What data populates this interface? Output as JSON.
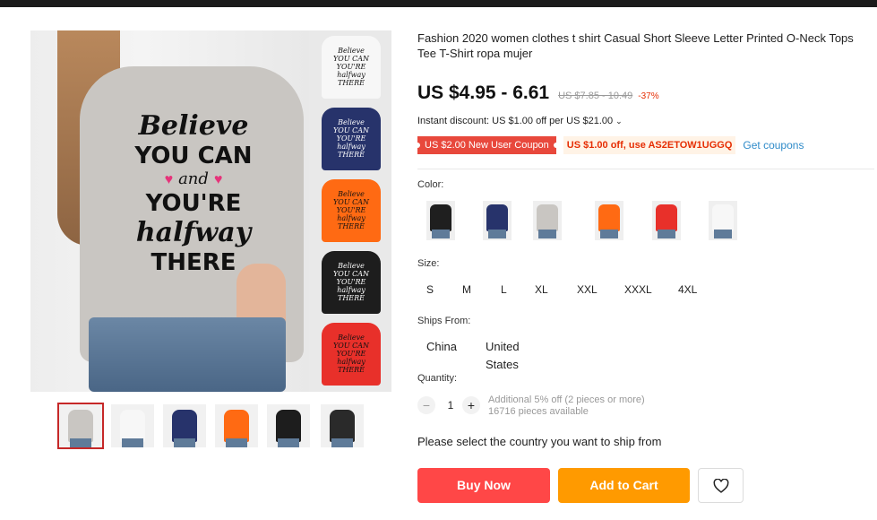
{
  "product": {
    "title": "Fashion 2020 women clothes t shirt Casual Short Sleeve Letter Printed O-Neck Tops Tee T-Shirt ropa mujer",
    "price": "US $4.95 - 6.61",
    "original_price": "US $7.85 - 10.49",
    "discount_percent": "-37%",
    "instant_discount": "Instant discount: US $1.00 off per US $21.00",
    "new_user_coupon": "US $2.00 New User Coupon",
    "store_coupon": "US $1.00 off, use AS2ETOW1UGGQ",
    "get_coupons": "Get coupons"
  },
  "gallery": {
    "print_lines": [
      "Believe",
      "YOU CAN",
      "and",
      "YOU'RE",
      "halfway",
      "THERE"
    ],
    "variant_text": [
      "Believe",
      "YOU CAN",
      "YOU'RE",
      "halfway",
      "THERE"
    ],
    "strip_colors": [
      "#f7f7f7",
      "#27336b",
      "#ff6a13",
      "#1d1d1d",
      "#e8302a"
    ],
    "thumb_colors": [
      "#c9c6c2",
      "#f7f7f7",
      "#27336b",
      "#ff6a13",
      "#1d1d1d",
      "#2a2a2a"
    ]
  },
  "options": {
    "color_label": "Color:",
    "colors": [
      "#1f1f1f",
      "#27336b",
      "#c9c6c2",
      "#ff6a13",
      "#e8302a",
      "#f7f7f7"
    ],
    "size_label": "Size:",
    "sizes": [
      "S",
      "M",
      "L",
      "XL",
      "XXL",
      "XXXL",
      "4XL"
    ],
    "ships_label": "Ships From:",
    "ships_from": [
      "China",
      "United States"
    ],
    "quantity_label": "Quantity:",
    "quantity": "1",
    "qty_minus": "−",
    "qty_plus": "+",
    "bulk_note": "Additional 5% off (2 pieces or more)",
    "stock_note": "16716 pieces available",
    "ship_country": "Please select the country you want to ship from"
  },
  "actions": {
    "buy_now": "Buy Now",
    "add_to_cart": "Add to Cart"
  },
  "colors": {
    "price_red": "#e62e04",
    "buy_now_bg": "#ff4747",
    "add_to_cart_bg": "#ff9a00",
    "coupon_bg": "#e8483c",
    "link_blue": "#2f8bc9"
  }
}
